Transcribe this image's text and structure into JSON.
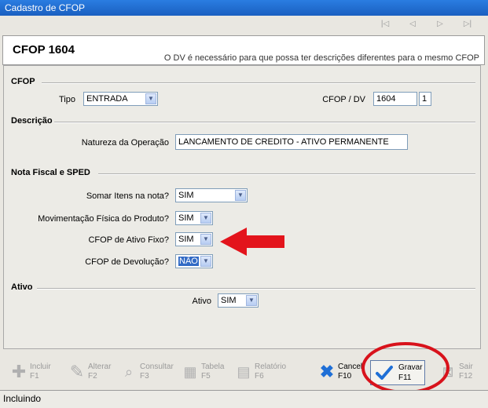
{
  "window": {
    "title": "Cadastro de CFOP"
  },
  "nav": {
    "first": "|◁",
    "prev": "◁",
    "next": "▷",
    "last": "▷|"
  },
  "header": {
    "title": "CFOP 1604",
    "hint": "O DV é necessário para que possa ter descrições diferentes para o mesmo CFOP"
  },
  "sections": {
    "cfop": "CFOP",
    "descricao": "Descrição",
    "nota": "Nota Fiscal e SPED",
    "ativo": "Ativo"
  },
  "cfop": {
    "tipo_label": "Tipo",
    "tipo_value": "ENTRADA",
    "cfopdv_label": "CFOP / DV",
    "cfop_value": "1604",
    "dv_value": "1"
  },
  "descricao": {
    "natureza_label": "Natureza da Operação",
    "natureza_value": "LANCAMENTO DE CREDITO - ATIVO PERMANENTE"
  },
  "nota": {
    "somar_label": "Somar Itens na nota?",
    "somar_value": "SIM",
    "mov_label": "Movimentação Física do Produto?",
    "mov_value": "SIM",
    "ativo_fixo_label": "CFOP de Ativo Fixo?",
    "ativo_fixo_value": "SIM",
    "devolucao_label": "CFOP de Devolução?",
    "devolucao_value": "NÃO"
  },
  "ativo": {
    "label": "Ativo",
    "value": "SIM"
  },
  "toolbar": {
    "incluir": {
      "label": "Incluir",
      "key": "F1"
    },
    "alterar": {
      "label": "Alterar",
      "key": "F2"
    },
    "consultar": {
      "label": "Consultar",
      "key": "F3"
    },
    "tabela": {
      "label": "Tabela",
      "key": "F5"
    },
    "relatorio": {
      "label": "Relatório",
      "key": "F6"
    },
    "cancelar": {
      "label": "Cancel",
      "key": "F10"
    },
    "gravar": {
      "label": "Gravar",
      "key": "F11"
    },
    "sair": {
      "label": "Sair",
      "key": "F12"
    }
  },
  "status": {
    "text": "Incluindo"
  },
  "colors": {
    "arrow": "#e3141c",
    "circle": "#d8121b",
    "titlebar": "#1a5fc0",
    "check": "#1f6fd6"
  }
}
